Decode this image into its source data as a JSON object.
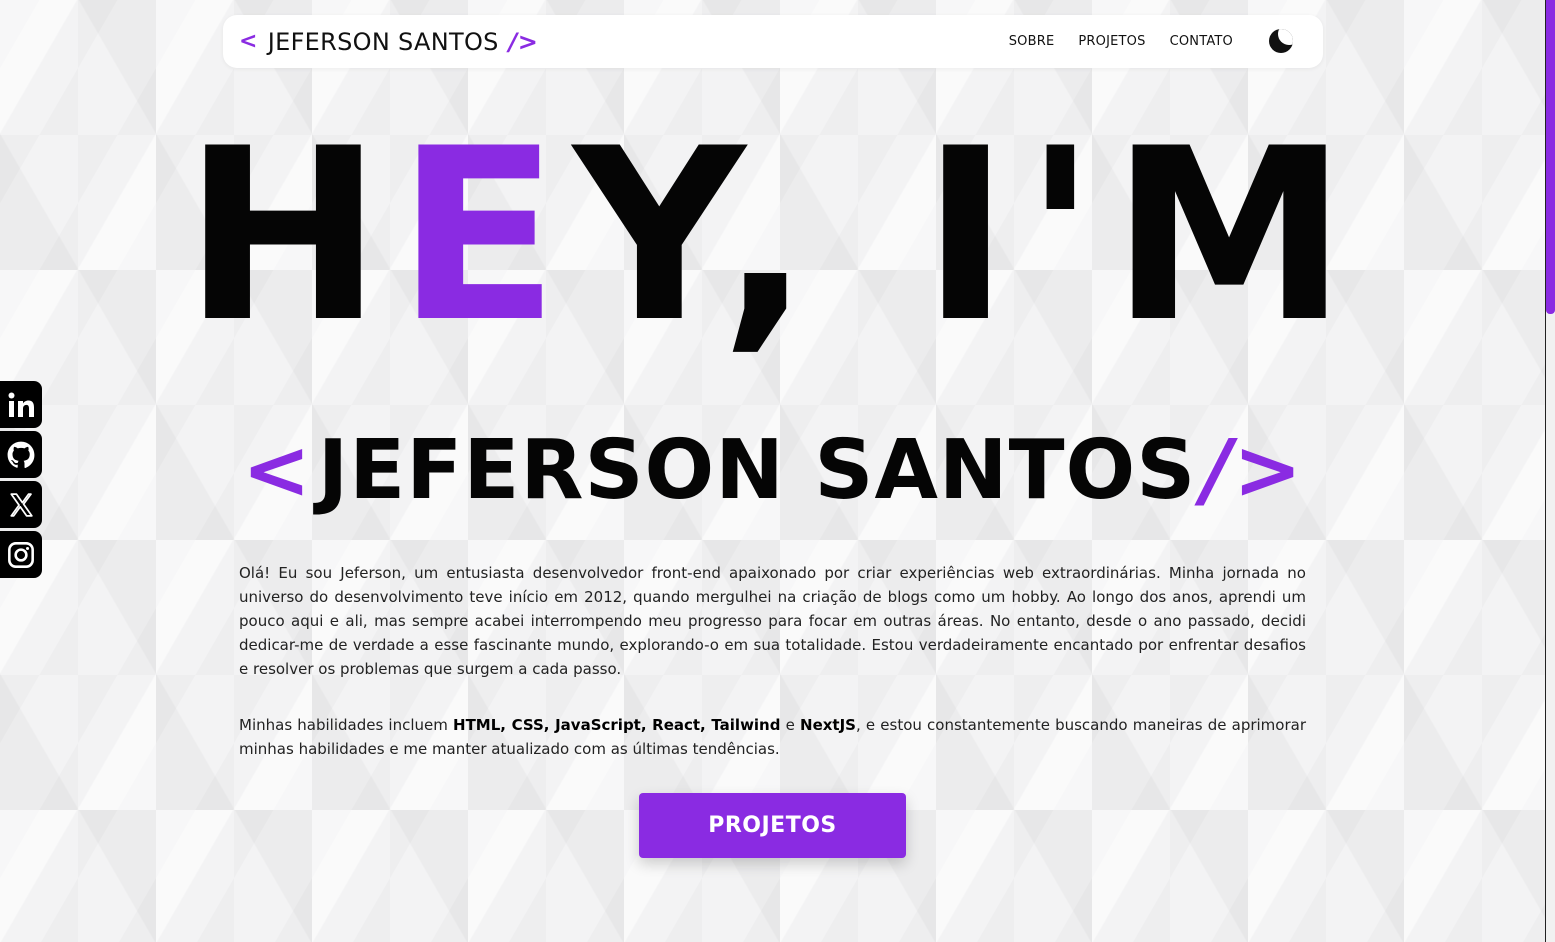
{
  "navbar": {
    "brand_open": "<",
    "brand_name": "JEFERSON SANTOS",
    "brand_close": "/>",
    "links": [
      "SOBRE",
      "PROJETOS",
      "CONTATO"
    ],
    "theme_icon": "moon-icon"
  },
  "hero": {
    "title_before": "H",
    "title_accent": "E",
    "title_after": "Y, I'M",
    "name_open": "<",
    "name": "JEFERSON SANTOS",
    "name_close": "/>"
  },
  "about": {
    "paragraph1": "Olá! Eu sou Jeferson, um entusiasta desenvolvedor front-end apaixonado por criar experiências web extraordinárias. Minha jornada no universo do desenvolvimento teve início em 2012, quando mergulhei na criação de blogs como um hobby. Ao longo dos anos, aprendi um pouco aqui e ali, mas sempre acabei interrompendo meu progresso para focar em outras áreas. No entanto, desde o ano passado, decidi dedicar-me de verdade a esse fascinante mundo, explorando-o em sua totalidade. Estou verdadeiramente encantado por enfrentar desafios e resolver os problemas que surgem a cada passo.",
    "p2_intro": "Minhas habilidades incluem ",
    "p2_skills": "HTML, CSS, JavaScript, React, Tailwind",
    "p2_and": " e ",
    "p2_last": "NextJS",
    "p2_outro": ", e estou constantemente buscando maneiras de aprimorar minhas habilidades e me manter atualizado com as últimas tendências."
  },
  "cta": {
    "label": "PROJETOS"
  },
  "social": [
    "linkedin-icon",
    "github-icon",
    "x-twitter-icon",
    "instagram-icon"
  ],
  "colors": {
    "accent": "#8a2be2",
    "text": "#050505",
    "background": "#f3f3f4"
  }
}
